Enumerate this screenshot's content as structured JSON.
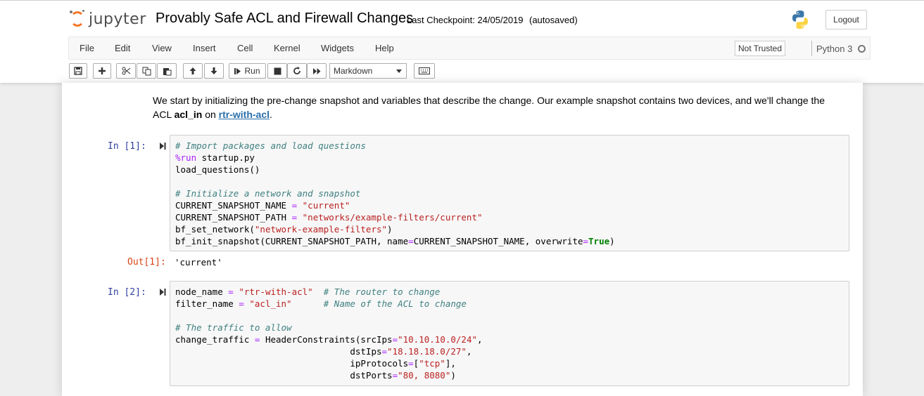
{
  "header": {
    "logo_text": "jupyter",
    "notebook_title": "Provably Safe ACL and Firewall Changes",
    "checkpoint": "Last Checkpoint: 24/05/2019",
    "autosave_status": "(autosaved)",
    "logout_label": "Logout"
  },
  "menubar": {
    "items": [
      "File",
      "Edit",
      "View",
      "Insert",
      "Cell",
      "Kernel",
      "Widgets",
      "Help"
    ],
    "trust_label": "Not Trusted",
    "kernel_name": "Python 3"
  },
  "toolbar": {
    "run_label": "Run",
    "cell_type": "Markdown"
  },
  "markdown": {
    "part1": "We start by initializing the pre-change snapshot and variables that describe the change. Our example snapshot contains two devices, and we'll change the ACL ",
    "acl_name": "acl_in",
    "part2": " on ",
    "router_link": "rtr-with-acl",
    "part3": "."
  },
  "cells": [
    {
      "prompt": "In [1]:",
      "lines": [
        [
          [
            "c",
            "# Import packages and load questions"
          ]
        ],
        [
          [
            "m",
            "%run"
          ],
          [
            "t",
            " startup.py"
          ]
        ],
        [
          [
            "t",
            "load_questions()"
          ]
        ],
        [
          [
            "t",
            ""
          ]
        ],
        [
          [
            "c",
            "# Initialize a network and snapshot"
          ]
        ],
        [
          [
            "t",
            "CURRENT_SNAPSHOT_NAME "
          ],
          [
            "o",
            "="
          ],
          [
            "t",
            " "
          ],
          [
            "s",
            "\"current\""
          ]
        ],
        [
          [
            "t",
            "CURRENT_SNAPSHOT_PATH "
          ],
          [
            "o",
            "="
          ],
          [
            "t",
            " "
          ],
          [
            "s",
            "\"networks/example-filters/current\""
          ]
        ],
        [
          [
            "t",
            "bf_set_network("
          ],
          [
            "s",
            "\"network-example-filters\""
          ],
          [
            "t",
            ")"
          ]
        ],
        [
          [
            "t",
            "bf_init_snapshot(CURRENT_SNAPSHOT_PATH, name"
          ],
          [
            "o",
            "="
          ],
          [
            "t",
            "CURRENT_SNAPSHOT_NAME, overwrite"
          ],
          [
            "o",
            "="
          ],
          [
            "k",
            "True"
          ],
          [
            "t",
            ")"
          ]
        ]
      ],
      "out_prompt": "Out[1]:",
      "output": "'current'"
    },
    {
      "prompt": "In [2]:",
      "lines": [
        [
          [
            "t",
            "node_name "
          ],
          [
            "o",
            "="
          ],
          [
            "t",
            " "
          ],
          [
            "s",
            "\"rtr-with-acl\""
          ],
          [
            "t",
            "  "
          ],
          [
            "c",
            "# The router to change"
          ]
        ],
        [
          [
            "t",
            "filter_name "
          ],
          [
            "o",
            "="
          ],
          [
            "t",
            " "
          ],
          [
            "s",
            "\"acl_in\""
          ],
          [
            "t",
            "      "
          ],
          [
            "c",
            "# Name of the ACL to change"
          ]
        ],
        [
          [
            "t",
            ""
          ]
        ],
        [
          [
            "c",
            "# The traffic to allow"
          ]
        ],
        [
          [
            "t",
            "change_traffic "
          ],
          [
            "o",
            "="
          ],
          [
            "t",
            " HeaderConstraints(srcIps"
          ],
          [
            "o",
            "="
          ],
          [
            "s",
            "\"10.10.10.0/24\""
          ],
          [
            "t",
            ","
          ]
        ],
        [
          [
            "t",
            "                                 dstIps"
          ],
          [
            "o",
            "="
          ],
          [
            "s",
            "\"18.18.18.0/27\""
          ],
          [
            "t",
            ","
          ]
        ],
        [
          [
            "t",
            "                                 ipProtocols"
          ],
          [
            "o",
            "="
          ],
          [
            "t",
            "["
          ],
          [
            "s",
            "\"tcp\""
          ],
          [
            "t",
            "],"
          ]
        ],
        [
          [
            "t",
            "                                 dstPorts"
          ],
          [
            "o",
            "="
          ],
          [
            "s",
            "\"80, 8080\""
          ],
          [
            "t",
            ")"
          ]
        ]
      ]
    }
  ],
  "colors": {
    "accent_orange": "#f37726",
    "in_prompt": "#303f9f",
    "out_prompt": "#d84315",
    "link": "#296eaa"
  }
}
